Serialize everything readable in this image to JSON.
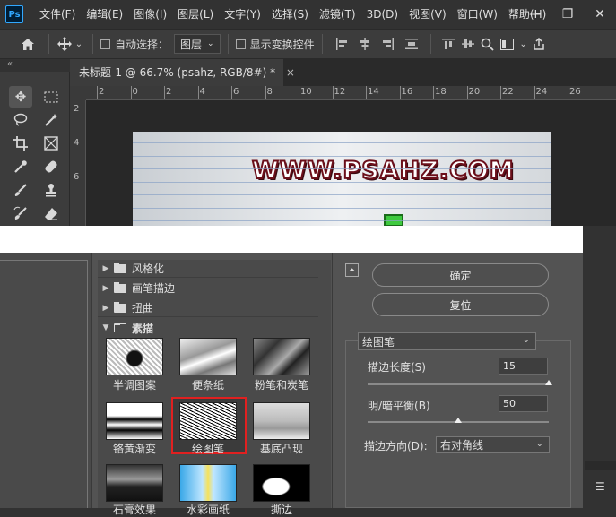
{
  "app": {
    "logo": "Ps"
  },
  "menu": [
    "文件(F)",
    "编辑(E)",
    "图像(I)",
    "图层(L)",
    "文字(Y)",
    "选择(S)",
    "滤镜(T)",
    "3D(D)",
    "视图(V)",
    "窗口(W)",
    "帮助(H)"
  ],
  "window_controls": {
    "minimize": "—",
    "restore": "❐",
    "close": "✕"
  },
  "options": {
    "auto_select_label": "自动选择：",
    "auto_select_value": "图层",
    "show_transform_label": "显示变换控件"
  },
  "toolbar": {
    "collapse": "«"
  },
  "document_tab": {
    "title": "未标题-1 @ 66.7% (psahz, RGB/8#) *",
    "close": "×"
  },
  "ruler": {
    "h_ticks": [
      "2",
      "0",
      "2",
      "4",
      "6",
      "8",
      "10",
      "12",
      "14",
      "16",
      "18",
      "20",
      "22",
      "24",
      "26"
    ],
    "v_ticks": [
      "2",
      "4",
      "6"
    ]
  },
  "canvas": {
    "watermark": "WWW.PSAHZ.COM"
  },
  "filter_gallery": {
    "categories": [
      {
        "label": "风格化",
        "open": false
      },
      {
        "label": "画笔描边",
        "open": false
      },
      {
        "label": "扭曲",
        "open": false
      },
      {
        "label": "素描",
        "open": true
      }
    ],
    "thumbnails": [
      {
        "label": "半调图案"
      },
      {
        "label": "便条纸"
      },
      {
        "label": "粉笔和炭笔"
      },
      {
        "label": "铬黄渐变"
      },
      {
        "label": "绘图笔",
        "selected": true
      },
      {
        "label": "基底凸现"
      },
      {
        "label": "石膏效果"
      },
      {
        "label": "水彩画纸"
      },
      {
        "label": "撕边"
      }
    ],
    "ok_button": "确定",
    "reset_button": "复位",
    "collapse_icon": "⏶",
    "selected_filter": "绘图笔",
    "params": {
      "stroke_length_label": "描边长度(S)",
      "stroke_length_value": "15",
      "stroke_length_level": 1.0,
      "light_dark_label": "明/暗平衡(B)",
      "light_dark_value": "50",
      "light_dark_level": 0.5,
      "direction_label": "描边方向(D):",
      "direction_value": "右对角线"
    }
  },
  "colors": {
    "accent_blue": "#31a8ff",
    "selection_red": "#e02020",
    "watermark_stroke": "#6b0f1a"
  }
}
